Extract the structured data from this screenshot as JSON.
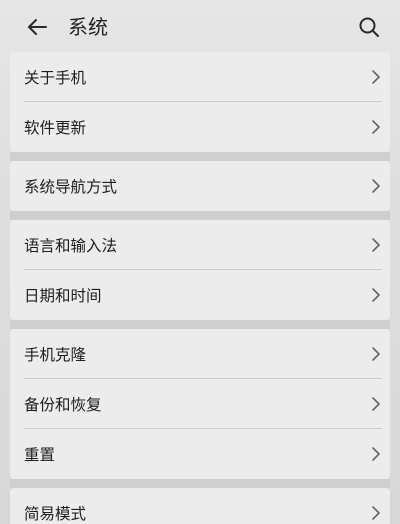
{
  "header": {
    "title": "系统",
    "back_icon": "arrow-left-icon",
    "search_icon": "search-icon"
  },
  "groups": [
    {
      "items": [
        {
          "label": "关于手机"
        },
        {
          "label": "软件更新"
        }
      ]
    },
    {
      "items": [
        {
          "label": "系统导航方式"
        }
      ]
    },
    {
      "items": [
        {
          "label": "语言和输入法"
        },
        {
          "label": "日期和时间"
        }
      ]
    },
    {
      "items": [
        {
          "label": "手机克隆"
        },
        {
          "label": "备份和恢复"
        },
        {
          "label": "重置"
        }
      ]
    },
    {
      "items": [
        {
          "label": "简易模式"
        }
      ]
    }
  ]
}
